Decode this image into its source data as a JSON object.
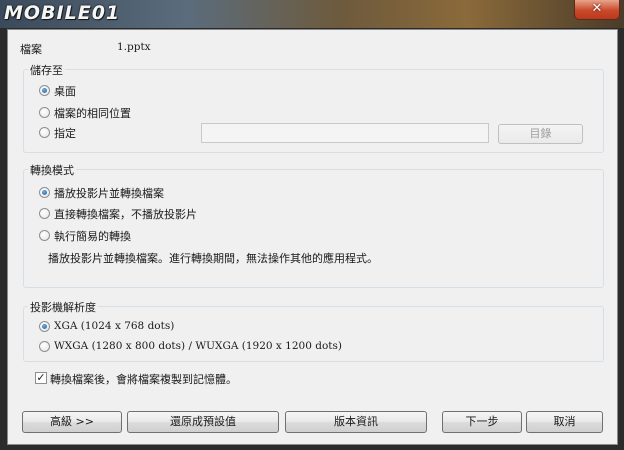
{
  "window": {
    "logo_text": "MOBILE01",
    "close_glyph": "✕"
  },
  "file": {
    "label": "檔案",
    "name": "1.pptx"
  },
  "save_to": {
    "title": "儲存至",
    "options": [
      "桌面",
      "檔案的相同位置",
      "指定"
    ],
    "selected": 0,
    "path_value": "",
    "browse_label": "目錄"
  },
  "convert_mode": {
    "title": "轉換模式",
    "options": [
      "播放投影片並轉換檔案",
      "直接轉換檔案，不播放投影片",
      "執行簡易的轉換"
    ],
    "selected": 0,
    "description": "播放投影片並轉換檔案。進行轉換期間，無法操作其他的應用程式。"
  },
  "resolution": {
    "title": "投影機解析度",
    "options": [
      "XGA (1024 x 768 dots)",
      "WXGA (1280 x 800 dots) / WUXGA (1920 x 1200 dots)"
    ],
    "selected": 0
  },
  "copy_to_memory": {
    "label": "轉換檔案後，會將檔案複製到記憶體。",
    "checked": true
  },
  "buttons": {
    "advanced": "高級 >>",
    "restore_defaults": "還原成預設值",
    "version_info": "版本資訊",
    "next": "下一步",
    "cancel": "取消"
  }
}
